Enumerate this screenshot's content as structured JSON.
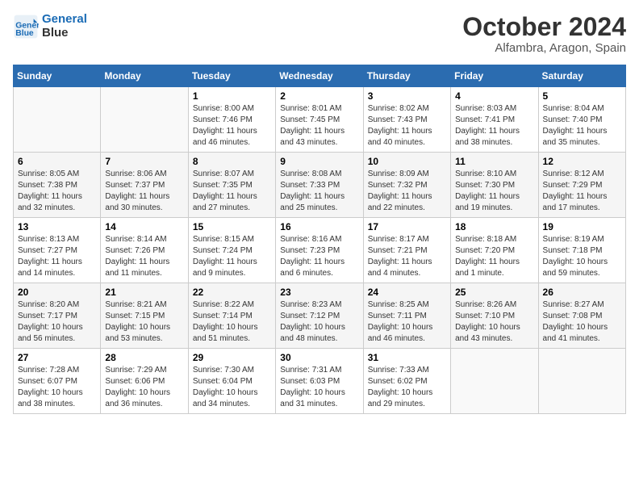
{
  "header": {
    "logo_line1": "General",
    "logo_line2": "Blue",
    "month": "October 2024",
    "location": "Alfambra, Aragon, Spain"
  },
  "weekdays": [
    "Sunday",
    "Monday",
    "Tuesday",
    "Wednesday",
    "Thursday",
    "Friday",
    "Saturday"
  ],
  "weeks": [
    [
      {
        "day": "",
        "info": ""
      },
      {
        "day": "",
        "info": ""
      },
      {
        "day": "1",
        "info": "Sunrise: 8:00 AM\nSunset: 7:46 PM\nDaylight: 11 hours and 46 minutes."
      },
      {
        "day": "2",
        "info": "Sunrise: 8:01 AM\nSunset: 7:45 PM\nDaylight: 11 hours and 43 minutes."
      },
      {
        "day": "3",
        "info": "Sunrise: 8:02 AM\nSunset: 7:43 PM\nDaylight: 11 hours and 40 minutes."
      },
      {
        "day": "4",
        "info": "Sunrise: 8:03 AM\nSunset: 7:41 PM\nDaylight: 11 hours and 38 minutes."
      },
      {
        "day": "5",
        "info": "Sunrise: 8:04 AM\nSunset: 7:40 PM\nDaylight: 11 hours and 35 minutes."
      }
    ],
    [
      {
        "day": "6",
        "info": "Sunrise: 8:05 AM\nSunset: 7:38 PM\nDaylight: 11 hours and 32 minutes."
      },
      {
        "day": "7",
        "info": "Sunrise: 8:06 AM\nSunset: 7:37 PM\nDaylight: 11 hours and 30 minutes."
      },
      {
        "day": "8",
        "info": "Sunrise: 8:07 AM\nSunset: 7:35 PM\nDaylight: 11 hours and 27 minutes."
      },
      {
        "day": "9",
        "info": "Sunrise: 8:08 AM\nSunset: 7:33 PM\nDaylight: 11 hours and 25 minutes."
      },
      {
        "day": "10",
        "info": "Sunrise: 8:09 AM\nSunset: 7:32 PM\nDaylight: 11 hours and 22 minutes."
      },
      {
        "day": "11",
        "info": "Sunrise: 8:10 AM\nSunset: 7:30 PM\nDaylight: 11 hours and 19 minutes."
      },
      {
        "day": "12",
        "info": "Sunrise: 8:12 AM\nSunset: 7:29 PM\nDaylight: 11 hours and 17 minutes."
      }
    ],
    [
      {
        "day": "13",
        "info": "Sunrise: 8:13 AM\nSunset: 7:27 PM\nDaylight: 11 hours and 14 minutes."
      },
      {
        "day": "14",
        "info": "Sunrise: 8:14 AM\nSunset: 7:26 PM\nDaylight: 11 hours and 11 minutes."
      },
      {
        "day": "15",
        "info": "Sunrise: 8:15 AM\nSunset: 7:24 PM\nDaylight: 11 hours and 9 minutes."
      },
      {
        "day": "16",
        "info": "Sunrise: 8:16 AM\nSunset: 7:23 PM\nDaylight: 11 hours and 6 minutes."
      },
      {
        "day": "17",
        "info": "Sunrise: 8:17 AM\nSunset: 7:21 PM\nDaylight: 11 hours and 4 minutes."
      },
      {
        "day": "18",
        "info": "Sunrise: 8:18 AM\nSunset: 7:20 PM\nDaylight: 11 hours and 1 minute."
      },
      {
        "day": "19",
        "info": "Sunrise: 8:19 AM\nSunset: 7:18 PM\nDaylight: 10 hours and 59 minutes."
      }
    ],
    [
      {
        "day": "20",
        "info": "Sunrise: 8:20 AM\nSunset: 7:17 PM\nDaylight: 10 hours and 56 minutes."
      },
      {
        "day": "21",
        "info": "Sunrise: 8:21 AM\nSunset: 7:15 PM\nDaylight: 10 hours and 53 minutes."
      },
      {
        "day": "22",
        "info": "Sunrise: 8:22 AM\nSunset: 7:14 PM\nDaylight: 10 hours and 51 minutes."
      },
      {
        "day": "23",
        "info": "Sunrise: 8:23 AM\nSunset: 7:12 PM\nDaylight: 10 hours and 48 minutes."
      },
      {
        "day": "24",
        "info": "Sunrise: 8:25 AM\nSunset: 7:11 PM\nDaylight: 10 hours and 46 minutes."
      },
      {
        "day": "25",
        "info": "Sunrise: 8:26 AM\nSunset: 7:10 PM\nDaylight: 10 hours and 43 minutes."
      },
      {
        "day": "26",
        "info": "Sunrise: 8:27 AM\nSunset: 7:08 PM\nDaylight: 10 hours and 41 minutes."
      }
    ],
    [
      {
        "day": "27",
        "info": "Sunrise: 7:28 AM\nSunset: 6:07 PM\nDaylight: 10 hours and 38 minutes."
      },
      {
        "day": "28",
        "info": "Sunrise: 7:29 AM\nSunset: 6:06 PM\nDaylight: 10 hours and 36 minutes."
      },
      {
        "day": "29",
        "info": "Sunrise: 7:30 AM\nSunset: 6:04 PM\nDaylight: 10 hours and 34 minutes."
      },
      {
        "day": "30",
        "info": "Sunrise: 7:31 AM\nSunset: 6:03 PM\nDaylight: 10 hours and 31 minutes."
      },
      {
        "day": "31",
        "info": "Sunrise: 7:33 AM\nSunset: 6:02 PM\nDaylight: 10 hours and 29 minutes."
      },
      {
        "day": "",
        "info": ""
      },
      {
        "day": "",
        "info": ""
      }
    ]
  ]
}
